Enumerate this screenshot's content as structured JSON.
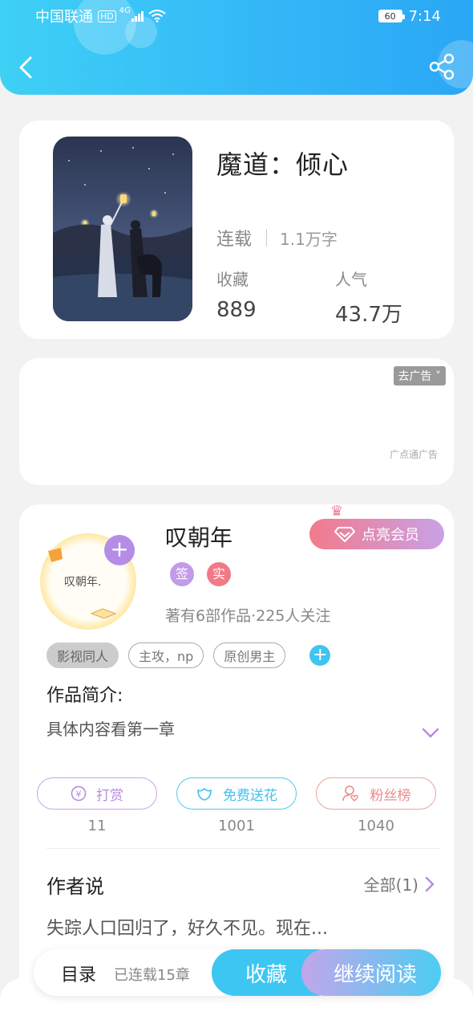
{
  "status_bar": {
    "carrier": "中国联通",
    "network": "HD",
    "signal": "4G",
    "battery": "60",
    "time": "7:14"
  },
  "book": {
    "title": "魔道：倾心",
    "status": "连载",
    "word_count": "1.1万字",
    "favorites_label": "收藏",
    "favorites_value": "889",
    "popularity_label": "人气",
    "popularity_value": "43.7万"
  },
  "ad": {
    "close_label": "去广告",
    "source": "广点通广告"
  },
  "author": {
    "name": "叹朝年",
    "avatar_text": "叹朝年.",
    "vip_label": "点亮会员",
    "badges": [
      "签",
      "实"
    ],
    "meta": "著有6部作品·225人关注",
    "tags": [
      "影视同人",
      "主攻，np",
      "原创男主"
    ],
    "intro_label": "作品简介:",
    "intro_text": "具体内容看第一章"
  },
  "actions": [
    {
      "label": "打赏",
      "count": "11",
      "color": "#b88be0"
    },
    {
      "label": "免费送花",
      "count": "1001",
      "color": "#3fc2ee"
    },
    {
      "label": "粉丝榜",
      "count": "1040",
      "color": "#ef8a8a"
    }
  ],
  "author_says": {
    "label": "作者说",
    "all": "全部(1)",
    "text": "失踪人口回归了，好久不见。现在..."
  },
  "bottom": {
    "toc": "目录",
    "toc_sub": "已连载15章",
    "favorite": "收藏",
    "continue": "继续阅读"
  }
}
